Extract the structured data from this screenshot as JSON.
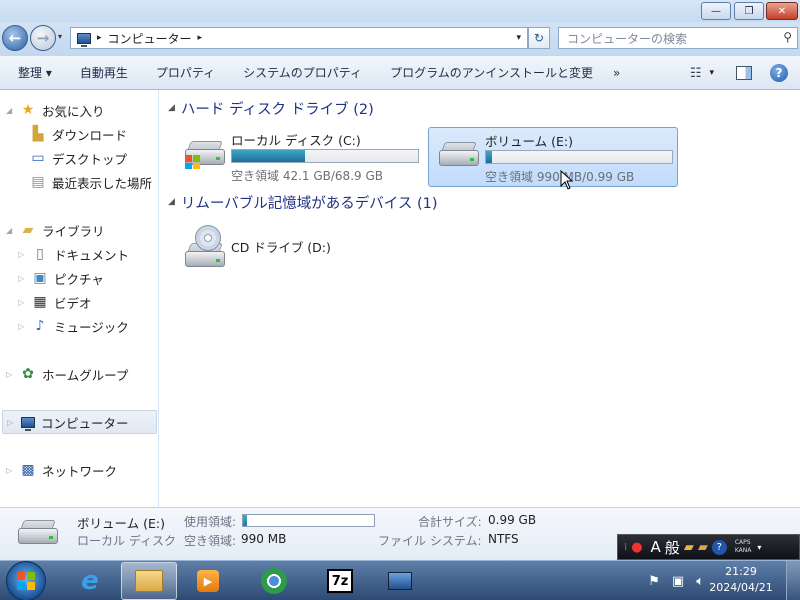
{
  "window": {
    "title_buttons": [
      "minimize",
      "maximize",
      "close"
    ],
    "minimize_label": "—",
    "maximize_label": "❐",
    "close_label": "✕"
  },
  "address_bar": {
    "path_segments": [
      "コンピューター"
    ],
    "search_placeholder": "コンピューターの検索"
  },
  "toolbar": {
    "items": [
      "整理 ▾",
      "自動再生",
      "プロパティ",
      "システムのプロパティ",
      "プログラムのアンインストールと変更",
      "»"
    ]
  },
  "sidebar": {
    "favorites": "お気に入り",
    "downloads": "ダウンロード",
    "desktop": "デスクトップ",
    "recent": "最近表示した場所",
    "libraries": "ライブラリ",
    "documents": "ドキュメント",
    "pictures": "ピクチャ",
    "videos": "ビデオ",
    "music": "ミュージック",
    "homegroup": "ホームグループ",
    "computer": "コンピューター",
    "network": "ネットワーク"
  },
  "main": {
    "hdd_group": "ハード ディスク ドライブ (2)",
    "removable_group": "リムーバブル記憶域があるデバイス (1)",
    "drives": [
      {
        "name": "ローカル ディスク (C:)",
        "free": "空き領域 42.1 GB/68.9 GB",
        "used_fraction": 0.39
      },
      {
        "name": "ボリューム (E:)",
        "free": "空き領域 990 MB/0.99 GB",
        "used_fraction": 0.03
      }
    ],
    "cd_drive": "CD ドライブ (D:)"
  },
  "details": {
    "name": "ボリューム (E:)",
    "type": "ローカル ディスク",
    "used_label": "使用領域:",
    "free_label": "空き領域:",
    "free_value": "990 MB",
    "total_label": "合計サイズ:",
    "total_value": "0.99 GB",
    "fs_label": "ファイル システム:",
    "fs_value": "NTFS",
    "used_fraction": 0.03
  },
  "ime": {
    "mode": "A",
    "kanji": "般",
    "caps": "CAPS",
    "kana": "KANA"
  },
  "clock": {
    "time": "21:29",
    "date": "2024/04/21"
  },
  "taskbar": {
    "seven_zip_label": "7z"
  },
  "colors": {
    "group_header": "#1e3287",
    "drive_bar_fill": "#1b6f9a",
    "selection": "#c1dbfc"
  }
}
